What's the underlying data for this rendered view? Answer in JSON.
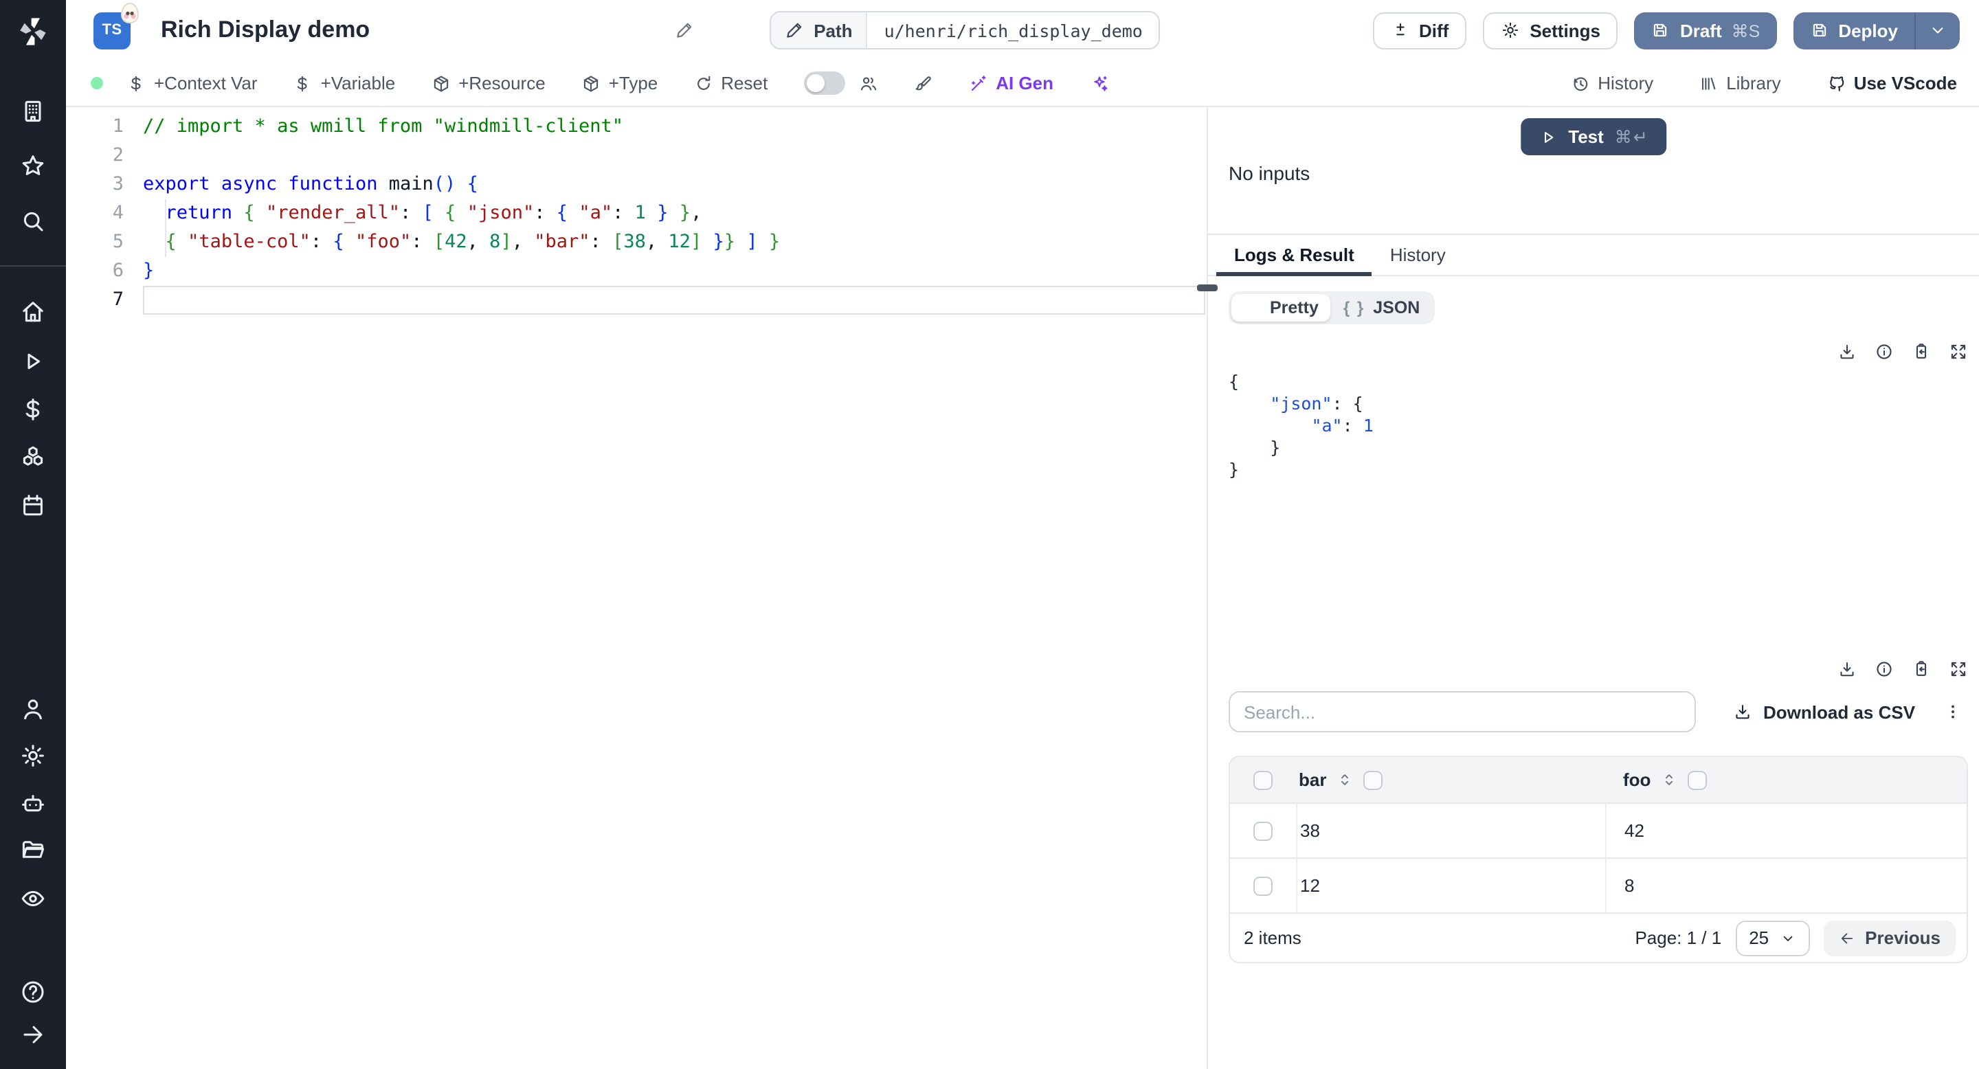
{
  "colors": {
    "btn-blue": "#62799f",
    "test-navy": "#384a67",
    "ai-purple": "#7c3aed",
    "status-green": "#86efac",
    "tab-dark": "#374151"
  },
  "topbar": {
    "language_badge": "TS",
    "title": "Rich Display demo",
    "path_label": "Path",
    "path_value": "u/henri/rich_display_demo",
    "diff_label": "Diff",
    "settings_label": "Settings",
    "draft_label": "Draft",
    "draft_kbd": "⌘S",
    "deploy_label": "Deploy"
  },
  "toolbar": {
    "context_var": "+Context Var",
    "variable": "+Variable",
    "resource": "+Resource",
    "type": "+Type",
    "reset": "Reset",
    "ai_gen": "AI Gen",
    "history": "History",
    "library": "Library",
    "use_vscode": "Use VScode"
  },
  "sidebar": {
    "items": [
      "building",
      "star",
      "search",
      "home",
      "play",
      "dollar",
      "boxes",
      "calendar",
      "user",
      "gear",
      "robot",
      "folder",
      "eye",
      "help",
      "arrow-right"
    ]
  },
  "editor": {
    "lines": [
      {
        "n": "1",
        "tokens": [
          [
            "// import * as wmill from \"windmill-client\"",
            "comment"
          ]
        ]
      },
      {
        "n": "2",
        "tokens": []
      },
      {
        "n": "3",
        "tokens": [
          [
            "export",
            "kw"
          ],
          [
            " "
          ],
          [
            "async",
            "kw"
          ],
          [
            " "
          ],
          [
            "function",
            "kw"
          ],
          [
            " "
          ],
          [
            "main",
            "plain"
          ],
          [
            "()",
            "bblue"
          ],
          [
            " "
          ],
          [
            "{",
            "bblue"
          ]
        ]
      },
      {
        "n": "4",
        "guide": true,
        "tokens": [
          [
            "  "
          ],
          [
            "return",
            "kw"
          ],
          [
            " "
          ],
          [
            "{",
            "bgreen"
          ],
          [
            " "
          ],
          [
            "\"render_all\"",
            "str"
          ],
          [
            ": "
          ],
          [
            "[",
            "bblue"
          ],
          [
            " "
          ],
          [
            "{",
            "bgreen"
          ],
          [
            " "
          ],
          [
            "\"json\"",
            "str"
          ],
          [
            ": "
          ],
          [
            "{",
            "bblue"
          ],
          [
            " "
          ],
          [
            "\"a\"",
            "str"
          ],
          [
            ": "
          ],
          [
            "1",
            "num"
          ],
          [
            " "
          ],
          [
            "}",
            "bblue"
          ],
          [
            " "
          ],
          [
            "}",
            "bgreen"
          ],
          [
            ","
          ]
        ]
      },
      {
        "n": "5",
        "guide": true,
        "tokens": [
          [
            "  "
          ],
          [
            "{",
            "bgreen"
          ],
          [
            " "
          ],
          [
            "\"table-col\"",
            "str"
          ],
          [
            ": "
          ],
          [
            "{",
            "bblue"
          ],
          [
            " "
          ],
          [
            "\"foo\"",
            "str"
          ],
          [
            ": "
          ],
          [
            "[",
            "bgreen"
          ],
          [
            "42",
            "num"
          ],
          [
            ", "
          ],
          [
            "8",
            "num"
          ],
          [
            "]",
            "bgreen"
          ],
          [
            ", "
          ],
          [
            "\"bar\"",
            "str"
          ],
          [
            ": "
          ],
          [
            "[",
            "bgreen"
          ],
          [
            "38",
            "num"
          ],
          [
            ", "
          ],
          [
            "12",
            "num"
          ],
          [
            "]",
            "bgreen"
          ],
          [
            " "
          ],
          [
            "}",
            "bblue"
          ],
          [
            "}",
            "bgreen"
          ],
          [
            " "
          ],
          [
            "]",
            "bblue"
          ],
          [
            " "
          ],
          [
            "}",
            "bgreen"
          ]
        ]
      },
      {
        "n": "6",
        "tokens": [
          [
            "}",
            "bblue"
          ]
        ]
      },
      {
        "n": "7",
        "active": true,
        "tokens": []
      }
    ]
  },
  "runpanel": {
    "test_label": "Test",
    "test_kbd": "⌘↵",
    "no_inputs": "No inputs",
    "tabs": [
      "Logs & Result",
      "History"
    ],
    "view_pretty": "Pretty",
    "view_json": "JSON",
    "braces_glyph": "{ }",
    "result_lines": [
      [
        [
          "{",
          "jp"
        ]
      ],
      [
        [
          "    "
        ],
        [
          "\"json\"",
          "key"
        ],
        [
          ": ",
          "jp"
        ],
        [
          "{",
          "jp"
        ]
      ],
      [
        [
          "        "
        ],
        [
          "\"a\"",
          "key"
        ],
        [
          ": ",
          "jp"
        ],
        [
          "1",
          "jnum"
        ]
      ],
      [
        [
          "    "
        ],
        [
          "}",
          "jp"
        ]
      ],
      [
        [
          "}",
          "jp"
        ]
      ]
    ],
    "search_placeholder": "Search...",
    "download_csv": "Download as CSV"
  },
  "result_table": {
    "type": "table",
    "columns": [
      "bar",
      "foo"
    ],
    "rows": [
      [
        "38",
        "42"
      ],
      [
        "12",
        "8"
      ]
    ],
    "items_count": "2 items",
    "page_label": "Page: 1 / 1",
    "page_size": "25",
    "previous_label": "Previous"
  }
}
